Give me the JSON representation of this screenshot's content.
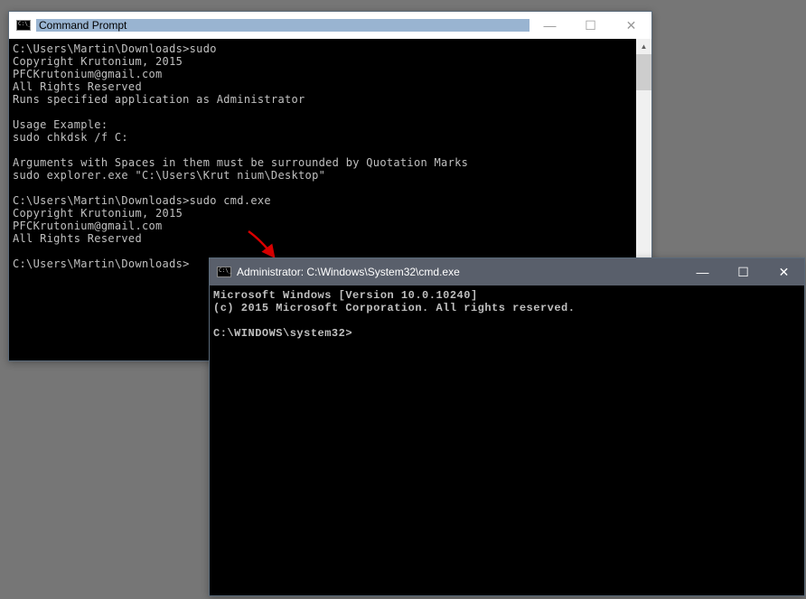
{
  "window1": {
    "title": "Command Prompt",
    "lines": [
      "C:\\Users\\Martin\\Downloads>sudo",
      "Copyright Krutonium, 2015",
      "PFCKrutonium@gmail.com",
      "All Rights Reserved",
      "Runs specified application as Administrator",
      "",
      "Usage Example:",
      "sudo chkdsk /f C:",
      "",
      "Arguments with Spaces in them must be surrounded by Quotation Marks",
      "sudo explorer.exe \"C:\\Users\\Krut nium\\Desktop\"",
      "",
      "C:\\Users\\Martin\\Downloads>sudo cmd.exe",
      "Copyright Krutonium, 2015",
      "PFCKrutonium@gmail.com",
      "All Rights Reserved",
      "",
      "C:\\Users\\Martin\\Downloads>"
    ]
  },
  "window2": {
    "title": "Administrator: C:\\Windows\\System32\\cmd.exe",
    "lines": [
      "Microsoft Windows [Version 10.0.10240]",
      "(c) 2015 Microsoft Corporation. All rights reserved.",
      "",
      "C:\\WINDOWS\\system32>"
    ]
  },
  "buttons": {
    "minimize": "—",
    "maximize": "☐",
    "close": "✕"
  }
}
